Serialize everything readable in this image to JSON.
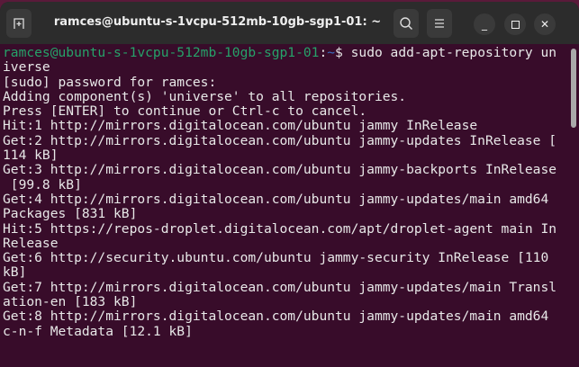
{
  "window": {
    "title": "ramces@ubuntu-s-1vcpu-512mb-10gb-sgp1-01: ~"
  },
  "prompt": {
    "user_host": "ramces@ubuntu-s-1vcpu-512mb-10gb-sgp1-01",
    "colon": ":",
    "path": "~",
    "symbol": "$",
    "command": " sudo add-apt-repository un"
  },
  "lines": [
    "iverse",
    "[sudo] password for ramces:",
    "Adding component(s) 'universe' to all repositories.",
    "Press [ENTER] to continue or Ctrl-c to cancel.",
    "Hit:1 http://mirrors.digitalocean.com/ubuntu jammy InRelease",
    "Get:2 http://mirrors.digitalocean.com/ubuntu jammy-updates InRelease [",
    "114 kB]",
    "Get:3 http://mirrors.digitalocean.com/ubuntu jammy-backports InRelease",
    " [99.8 kB]",
    "Get:4 http://mirrors.digitalocean.com/ubuntu jammy-updates/main amd64",
    "Packages [831 kB]",
    "Hit:5 https://repos-droplet.digitalocean.com/apt/droplet-agent main In",
    "Release",
    "Get:6 http://security.ubuntu.com/ubuntu jammy-security InRelease [110",
    "kB]",
    "Get:7 http://mirrors.digitalocean.com/ubuntu jammy-updates/main Transl",
    "ation-en [183 kB]",
    "Get:8 http://mirrors.digitalocean.com/ubuntu jammy-updates/main amd64",
    "c-n-f Metadata [12.1 kB]"
  ]
}
